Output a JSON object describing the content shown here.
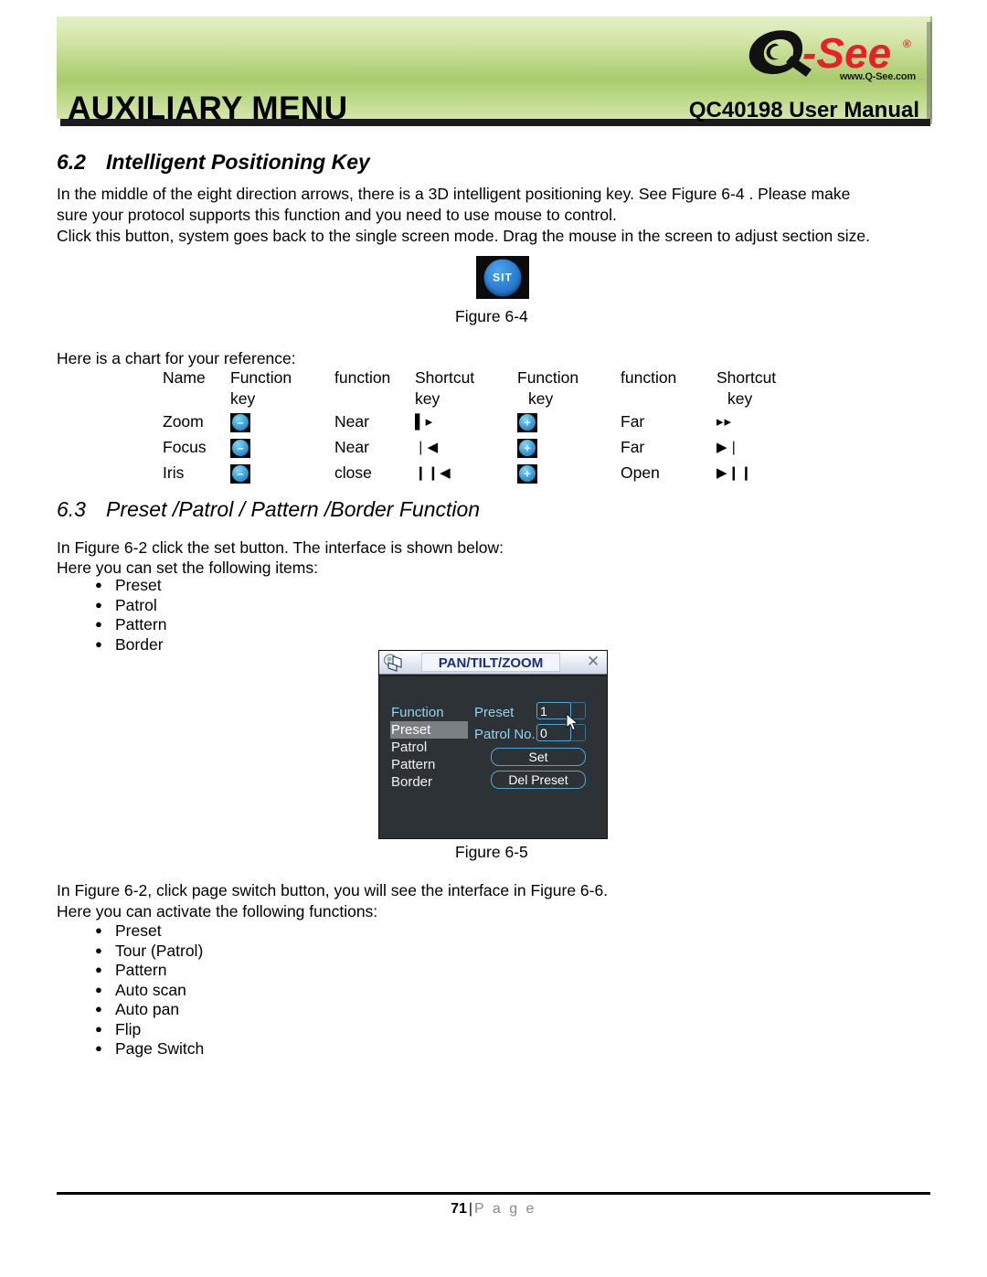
{
  "header": {
    "title": "AUXILIARY MENU",
    "manual": "QC40198 User Manual",
    "logo_q": "Q",
    "logo_dash_see": "-See",
    "logo_registered": "®",
    "logo_url": "www.Q-See.com"
  },
  "section62": {
    "number": "6.2",
    "title": "Intelligent Positioning Key",
    "para1": "In the middle of the eight direction arrows, there is a 3D intelligent positioning key. See Figure 6-4 . Please make",
    "para2": "sure your protocol supports this function and you need to use mouse to control.",
    "para3": "Click this button, system goes back to the single screen mode. Drag the mouse in the screen to adjust section size."
  },
  "figure64": {
    "button_label": "SIT",
    "caption": "Figure 6-4"
  },
  "chart_intro": "Here is a chart for your reference:",
  "chart_data": {
    "type": "table",
    "title": "Here is a chart for your reference:",
    "headers": [
      "Name",
      "Function key",
      "function",
      "Shortcut key",
      "Function key",
      "function",
      "Shortcut key"
    ],
    "header_lines": [
      [
        "Name",
        ""
      ],
      [
        "Function",
        "key"
      ],
      [
        "function",
        ""
      ],
      [
        "Shortcut",
        "key"
      ],
      [
        "Function",
        "key"
      ],
      [
        "function",
        ""
      ],
      [
        "Shortcut",
        "key"
      ]
    ],
    "rows": [
      {
        "name": "Zoom",
        "function_key_icon": "minus-button-icon",
        "function_key_sign": "–",
        "function": "Near",
        "shortcut": "▌▸",
        "function_key2_icon": "plus-button-icon",
        "function_key2_sign": "+",
        "function2": "Far",
        "shortcut2": "▸▸"
      },
      {
        "name": "Focus",
        "function_key_icon": "minus-button-icon",
        "function_key_sign": "–",
        "function": "Near",
        "shortcut": "❘◀",
        "function_key2_icon": "plus-button-icon",
        "function_key2_sign": "+",
        "function2": "Far",
        "shortcut2": "▶❘"
      },
      {
        "name": "Iris",
        "function_key_icon": "minus-button-icon",
        "function_key_sign": "–",
        "function": "close",
        "shortcut": "❙❙◀",
        "function_key2_icon": "plus-button-icon",
        "function_key2_sign": "+",
        "function2": "Open",
        "shortcut2": "▶❙❙"
      }
    ]
  },
  "section63": {
    "number": "6.3",
    "title": "Preset /Patrol / Pattern /Border  Function",
    "para1": "In Figure 6-2 click the set button. The interface is shown below:",
    "para2": "Here you can set the following items:",
    "items": [
      "Preset",
      "Patrol",
      "Pattern",
      "Border"
    ]
  },
  "ptz_dialog": {
    "camera_icon": "camera-icon",
    "title": "PAN/TILT/ZOOM",
    "close_icon": "✕",
    "menu": [
      "Function",
      "Preset",
      "Patrol",
      "Pattern",
      "Border"
    ],
    "selected_menu": "Preset",
    "fields": [
      {
        "label": "Preset",
        "value": "1"
      },
      {
        "label": "Patrol No.",
        "value": "0"
      }
    ],
    "buttons": [
      "Set",
      "Del Preset"
    ],
    "cursor_icon": "mouse-pointer-icon"
  },
  "figure65": {
    "caption": "Figure 6-5"
  },
  "section63b": {
    "para1": "In Figure 6-2, click page switch button, you will see the interface in Figure 6-6.",
    "para2": "Here you can activate the following functions:",
    "items": [
      "Preset",
      "Tour (Patrol)",
      "Pattern",
      "Auto scan",
      "Auto pan",
      "Flip",
      "Page Switch"
    ]
  },
  "footer": {
    "page_number": "71",
    "separator": "|",
    "page_word": "P a g e"
  },
  "colors": {
    "header_green": "#b8d481",
    "logo_red": "#e8202a",
    "dialog_bg": "#2d3236",
    "dialog_accent": "#8fd4f0",
    "button_blue": "#41a9e0"
  }
}
